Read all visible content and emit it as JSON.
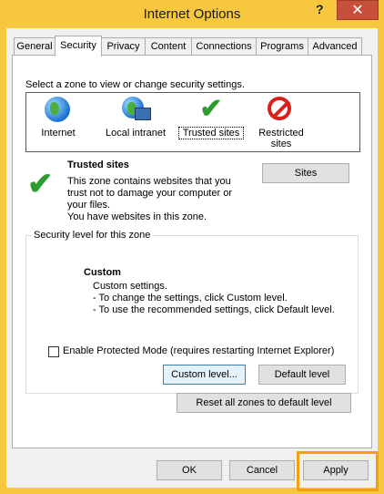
{
  "window": {
    "title": "Internet Options",
    "help_glyph": "?",
    "close_glyph": "✕"
  },
  "tabs": [
    {
      "label": "General"
    },
    {
      "label": "Security"
    },
    {
      "label": "Privacy"
    },
    {
      "label": "Content"
    },
    {
      "label": "Connections"
    },
    {
      "label": "Programs"
    },
    {
      "label": "Advanced"
    }
  ],
  "active_tab": "Security",
  "security": {
    "select_zone_text": "Select a zone to view or change security settings.",
    "zones": [
      {
        "label": "Internet",
        "icon": "globe-icon"
      },
      {
        "label": "Local intranet",
        "icon": "intranet-icon"
      },
      {
        "label": "Trusted sites",
        "icon": "checkmark-icon",
        "selected": true
      },
      {
        "label": "Restricted",
        "label2": "sites",
        "icon": "restricted-icon"
      }
    ],
    "zone_title": "Trusted sites",
    "zone_desc_1": "This zone contains websites that you",
    "zone_desc_2": "trust not to damage your computer or",
    "zone_desc_3": "your files.",
    "zone_desc_4": "You have websites in this zone.",
    "sites_button": "Sites",
    "level_group_title": "Security level for this zone",
    "level_name": "Custom",
    "level_line_1": "Custom settings.",
    "level_line_2": "- To change the settings, click Custom level.",
    "level_line_3": "- To use the recommended settings, click Default level.",
    "protected_mode_label": "Enable Protected Mode (requires restarting Internet Explorer)",
    "protected_mode_checked": false,
    "custom_level_button": "Custom level...",
    "default_level_button": "Default level",
    "reset_all_button": "Reset all zones to default level"
  },
  "footer": {
    "ok": "OK",
    "cancel": "Cancel",
    "apply": "Apply"
  },
  "colors": {
    "window_frame": "#f6c73f",
    "close_button": "#c7503a",
    "highlight": "#f0a010"
  }
}
